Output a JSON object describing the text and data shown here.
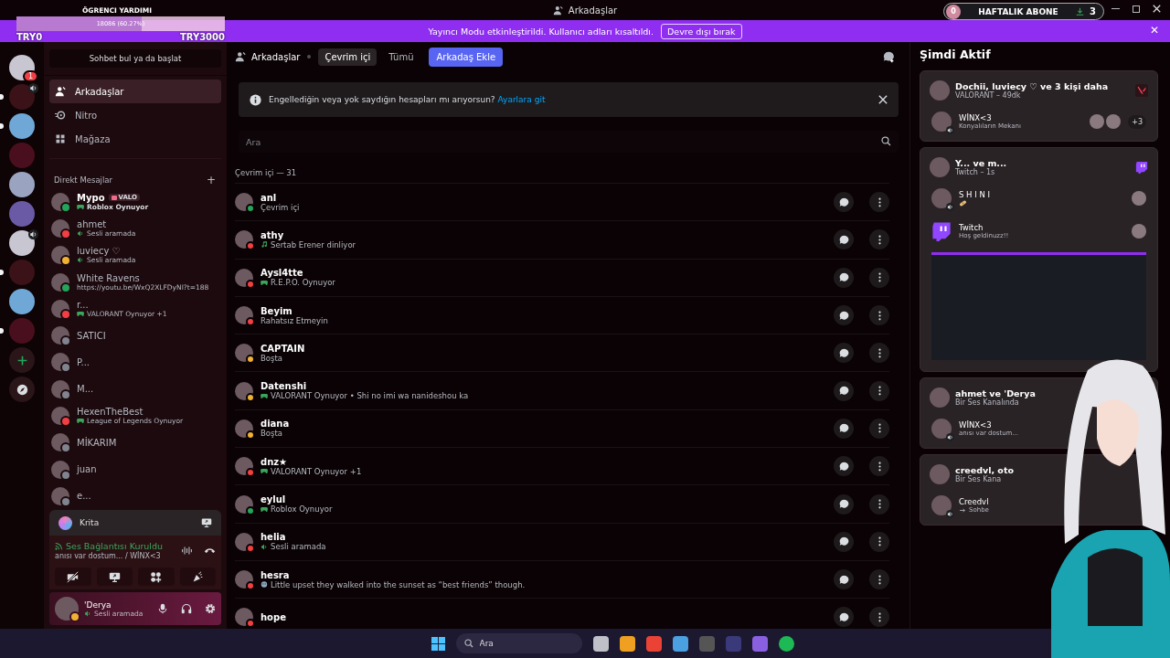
{
  "window": {
    "title": "Arkadaşlar"
  },
  "stream_overlay": {
    "goal_title": "ÖGRENCI YARDIMI",
    "progress_text": "18086 (60.27%)",
    "level": 0.6027,
    "start_label": "TRY0",
    "end_label": "TRY3000"
  },
  "sub_counter": {
    "count": "0",
    "label": "HAFTALIK ABONE",
    "recent": "3"
  },
  "banner": {
    "text": "Yayıncı Modu etkinleştirildi. Kullanıcı adları kısaltıldı.",
    "button": "Devre dışı bırak",
    "close": "✕"
  },
  "servers": [
    {
      "unread": false,
      "badge": "1",
      "voice": false
    },
    {
      "unread": true,
      "voice": true
    },
    {
      "unread": true,
      "voice": false
    },
    {
      "unread": false,
      "voice": false
    },
    {
      "unread": false,
      "voice": false
    },
    {
      "unread": false,
      "voice": false
    },
    {
      "unread": false,
      "voice": true
    },
    {
      "unread": true,
      "voice": false
    },
    {
      "unread": false,
      "voice": false
    },
    {
      "unread": true,
      "voice": false
    }
  ],
  "sidebar": {
    "search": "Sohbet bul ya da başlat",
    "nav": [
      {
        "kind": "friends",
        "label": "Arkadaşlar",
        "selected": true
      },
      {
        "kind": "nitro",
        "label": "Nitro",
        "selected": false
      },
      {
        "kind": "shop",
        "label": "Mağaza",
        "selected": false
      }
    ],
    "dm_header": "Direkt Mesajlar",
    "dm_add": "+",
    "dms": [
      {
        "name": "Mypo",
        "tag": "VALO",
        "activity": "Roblox Oynuyor",
        "kind": "game",
        "color": "#23a55a",
        "unread": true
      },
      {
        "name": "ahmet",
        "activity": "Sesli aramada",
        "kind": "voice",
        "color": "#f23f43",
        "unread": false
      },
      {
        "name": "luviecy ♡",
        "activity": "Sesli aramada",
        "kind": "voice",
        "color": "#f0b232",
        "unread": false
      },
      {
        "name": "White Ravens",
        "activity": "https://youtu.be/WxQ2XLFDyNI?t=188",
        "kind": "text",
        "color": "#23a55a",
        "unread": false
      },
      {
        "name": "r...",
        "activity": "VALORANT Oynuyor +1",
        "kind": "game",
        "color": "#f23f43",
        "unread": false
      },
      {
        "name": "SATICI",
        "color": "#80848e",
        "unread": false
      },
      {
        "name": "P...",
        "color": "#80848e",
        "unread": false
      },
      {
        "name": "M...",
        "color": "#80848e",
        "unread": false
      },
      {
        "name": "HexenTheBest",
        "activity": "League of Legends Oynuyor",
        "kind": "game",
        "color": "#f23f43",
        "unread": false
      },
      {
        "name": "MİKARIM",
        "color": "#80848e",
        "unread": false
      },
      {
        "name": "juan",
        "color": "#80848e",
        "unread": false
      },
      {
        "name": "e...",
        "color": "#80848e",
        "unread": false
      }
    ],
    "activity_panel": {
      "app": "Krita"
    },
    "voice_panel": {
      "status": "Ses Bağlantısı Kuruldu",
      "channel": "anısı var dostum... / WİNX<3"
    },
    "user_panel": {
      "name": "'Derya",
      "status_text": "Sesli aramada",
      "color": "#f0b232"
    }
  },
  "header": {
    "title": "Arkadaşlar",
    "tabs": [
      {
        "label": "Çevrim içi",
        "selected": true
      },
      {
        "label": "Tümü",
        "selected": false
      }
    ],
    "add_friend": "Arkadaş Ekle"
  },
  "notice": {
    "text": "Engellediğin veya yok saydığın hesapları mı arıyorsun?",
    "link": "Ayarlara git"
  },
  "search": {
    "placeholder": "Ara"
  },
  "list_header": "Çevrim içi — 31",
  "friends": [
    {
      "name": "anl",
      "activity": "Çevrim içi",
      "kind": "text",
      "color": "#23a55a"
    },
    {
      "name": "athy",
      "activity": "Sertab Erener dinliyor",
      "kind": "music",
      "color": "#f23f43"
    },
    {
      "name": "Aysl4tte",
      "activity": "R.E.P.O. Oynuyor",
      "kind": "game",
      "color": "#f23f43"
    },
    {
      "name": "Beyim",
      "activity": "Rahatsız Etmeyin",
      "kind": "text",
      "color": "#f23f43"
    },
    {
      "name": "CAPTAIN",
      "activity": "Boşta",
      "kind": "text",
      "color": "#f0b232"
    },
    {
      "name": "Datenshi",
      "activity": "VALORANT Oynuyor • Shi no imi wa nanideshou ka",
      "kind": "game",
      "color": "#f0b232"
    },
    {
      "name": "diana",
      "activity": "Boşta",
      "kind": "text",
      "color": "#f0b232"
    },
    {
      "name": "dnz★",
      "activity": "VALORANT Oynuyor +1",
      "kind": "game",
      "color": "#f23f43"
    },
    {
      "name": "eylul",
      "activity": "Roblox Oynuyor",
      "kind": "game",
      "color": "#23a55a"
    },
    {
      "name": "helia",
      "activity": "Sesli aramada",
      "kind": "voice",
      "color": "#f23f43"
    },
    {
      "name": "hesra",
      "activity": "Little upset they walked into the sunset as “best friends” though.",
      "kind": "emoji",
      "color": "#f23f43"
    },
    {
      "name": "hope",
      "color": "#f23f43"
    }
  ],
  "active_now": {
    "title": "Şimdi Aktif",
    "cards": [
      {
        "title": "Dochii, luviecy ♡ ve 3 kişi daha",
        "subtitle": "VALORANT – 49dk",
        "kind": "game",
        "entries": [
          {
            "kind": "member",
            "name": "WİNX<3",
            "detail": "Konyalıların Mekanı",
            "more": "+3"
          }
        ]
      },
      {
        "title": "Y... ve m...",
        "subtitle": "Twitch – 1s",
        "kind": "twitch",
        "entries": [
          {
            "kind": "member_emoji",
            "name": "S H I N I"
          },
          {
            "kind": "app",
            "name": "Twitch",
            "detail": "Hoş geldinuzz!!"
          },
          {
            "kind": "preview"
          }
        ]
      },
      {
        "title": "ahmet ve 'Derya",
        "subtitle": "Bir Ses Kanalında",
        "kind": "voice",
        "entries": [
          {
            "kind": "member",
            "name": "WİNX<3",
            "detail": "anısı var dostum..."
          }
        ]
      },
      {
        "title": "creedvl, oto",
        "subtitle": "Bir Ses Kana",
        "kind": "voice",
        "entries": [
          {
            "kind": "member",
            "name": "Creedvl",
            "detail": "Sohbe",
            "arrow": true
          }
        ]
      }
    ]
  },
  "taskbar": {
    "placeholder": "Ara"
  }
}
